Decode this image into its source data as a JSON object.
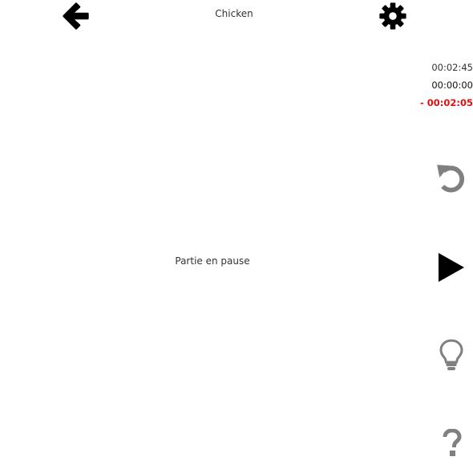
{
  "header": {
    "title": "Chicken",
    "back_icon": "arrow-left-icon",
    "settings_icon": "gear-icon"
  },
  "timers": {
    "total": "00:02:45",
    "elapsed": "00:00:00",
    "remaining": "- 00:02:05"
  },
  "status": {
    "message": "Partie en pause"
  },
  "controls": {
    "undo_icon": "undo-icon",
    "play_icon": "play-icon",
    "hint_icon": "lightbulb-icon",
    "help_icon": "question-icon"
  },
  "colors": {
    "remaining_timer": "#e01010",
    "icon_dark": "#000000",
    "icon_gray": "#808080"
  }
}
